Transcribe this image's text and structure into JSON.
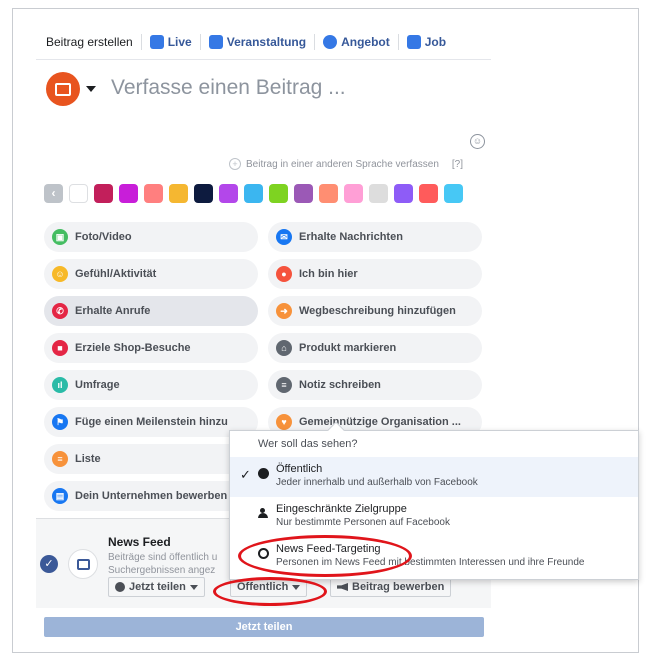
{
  "tabs": [
    {
      "label": "Beitrag erstellen",
      "icon": "none"
    },
    {
      "label": "Live",
      "icon": "live-icon"
    },
    {
      "label": "Veranstaltung",
      "icon": "calendar-icon"
    },
    {
      "label": "Angebot",
      "icon": "offer-icon"
    },
    {
      "label": "Job",
      "icon": "job-icon"
    }
  ],
  "composer": {
    "placeholder": "Verfasse einen Beitrag ...",
    "lang_link": "Beitrag in einer anderen Sprache verfassen",
    "lang_help": "[?]"
  },
  "swatch_colors": [
    "#ffffff",
    "#c21f5b",
    "#c81ed9",
    "#ff7f7f",
    "#f5b731",
    "#0d1b3f",
    "#b347ea",
    "#3bb6f0",
    "#7ed321",
    "#9b59b6",
    "#ff8e72",
    "#ff9fd6",
    "#dddddd",
    "#8e5cf7",
    "#ff5b5b",
    "#47c8f5"
  ],
  "actions": [
    {
      "label": "Foto/Video",
      "icon": "photo-icon",
      "color": "#45bd62"
    },
    {
      "label": "Erhalte Nachrichten",
      "icon": "messenger-icon",
      "color": "#1877f2"
    },
    {
      "label": "Gefühl/Aktivität",
      "icon": "smiley-icon",
      "color": "#f7b928"
    },
    {
      "label": "Ich bin hier",
      "icon": "location-pin-icon",
      "color": "#f5533d"
    },
    {
      "label": "Erhalte Anrufe",
      "icon": "phone-icon",
      "color": "#e42645"
    },
    {
      "label": "Wegbeschreibung hinzufügen",
      "icon": "directions-icon",
      "color": "#f7923b"
    },
    {
      "label": "Erziele Shop-Besuche",
      "icon": "shopping-bag-icon",
      "color": "#e42645"
    },
    {
      "label": "Produkt markieren",
      "icon": "tag-icon",
      "color": "#606770"
    },
    {
      "label": "Umfrage",
      "icon": "poll-icon",
      "color": "#2abba7"
    },
    {
      "label": "Notiz schreiben",
      "icon": "note-icon",
      "color": "#606770"
    },
    {
      "label": "Füge einen Meilenstein hinzu",
      "icon": "flag-icon",
      "color": "#1877f2"
    },
    {
      "label": "Gemeinnützige Organisation ...",
      "icon": "heart-icon",
      "color": "#f7923b"
    },
    {
      "label": "Liste",
      "icon": "list-icon",
      "color": "#f7923b"
    },
    {
      "label": "",
      "icon": "",
      "color": ""
    },
    {
      "label": "Dein Unternehmen bewerben",
      "icon": "promote-icon",
      "color": "#1877f2"
    },
    {
      "label": "",
      "icon": "",
      "color": ""
    }
  ],
  "feed": {
    "title": "News Feed",
    "desc_line1": "Beiträge sind öffentlich u",
    "desc_line2": "Suchergebnissen angez",
    "share_now": "Jetzt teilen",
    "audience": "Öffentlich",
    "boost": "Beitrag bewerben",
    "submit": "Jetzt teilen"
  },
  "popover": {
    "header": "Wer soll das sehen?",
    "options": [
      {
        "title": "Öffentlich",
        "desc": "Jeder innerhalb und außerhalb von Facebook",
        "icon": "globe-icon",
        "selected": true
      },
      {
        "title": "Eingeschränkte Zielgruppe",
        "desc": "Nur bestimmte Personen auf Facebook",
        "icon": "people-icon",
        "selected": false
      },
      {
        "title": "News Feed-Targeting",
        "desc": "Personen im News Feed mit bestimmten Interessen und ihre Freunde",
        "icon": "target-icon",
        "selected": false
      }
    ]
  },
  "colors": {
    "accent": "#3b5998",
    "annotation": "#e0151b",
    "avatar": "#e8541f"
  }
}
